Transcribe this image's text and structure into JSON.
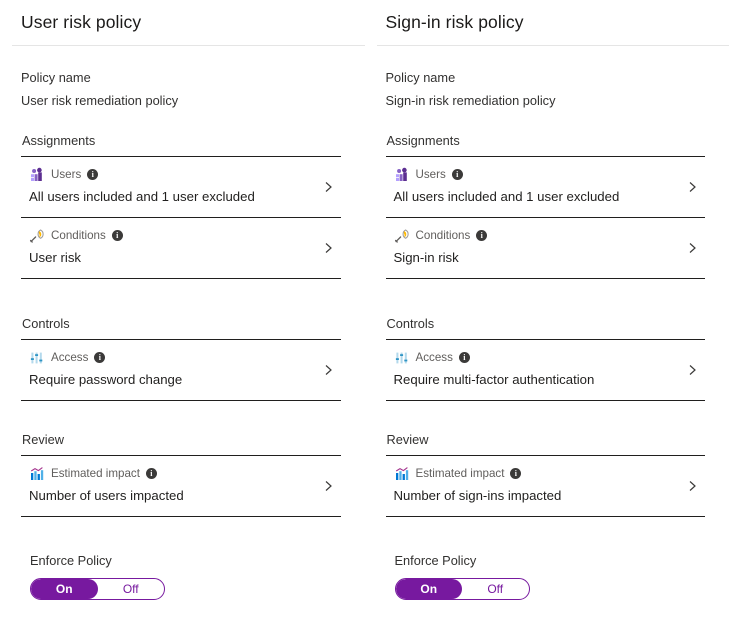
{
  "theme": {
    "accent_purple": "#77199f",
    "text_primary": "#201f1e",
    "text_secondary": "#605e5c",
    "divider": "#201f1e",
    "header_divider": "#e5e5e5"
  },
  "panels": [
    {
      "id": "user-risk-policy",
      "title": "User risk policy",
      "policy_name_label": "Policy name",
      "policy_name_value": "User risk remediation policy",
      "sections": [
        {
          "id": "assignments",
          "title": "Assignments",
          "rows": [
            {
              "id": "users",
              "icon": "users-icon",
              "label": "Users",
              "info": "i",
              "value": "All users included and 1 user excluded",
              "chevron": "chevron-right-icon"
            },
            {
              "id": "conditions",
              "icon": "conditions-icon",
              "label": "Conditions",
              "info": "i",
              "value": "User risk",
              "chevron": "chevron-right-icon"
            }
          ]
        },
        {
          "id": "controls",
          "title": "Controls",
          "rows": [
            {
              "id": "access",
              "icon": "access-icon",
              "label": "Access",
              "info": "i",
              "value": "Require password change",
              "chevron": "chevron-right-icon"
            }
          ]
        },
        {
          "id": "review",
          "title": "Review",
          "rows": [
            {
              "id": "estimated-impact",
              "icon": "estimated-impact-icon",
              "label": "Estimated impact",
              "info": "i",
              "value": "Number of users impacted",
              "chevron": "chevron-right-icon"
            }
          ]
        }
      ],
      "enforce": {
        "label": "Enforce Policy",
        "on_label": "On",
        "off_label": "Off",
        "selected": "On"
      }
    },
    {
      "id": "sign-in-risk-policy",
      "title": "Sign-in risk policy",
      "policy_name_label": "Policy name",
      "policy_name_value": "Sign-in risk remediation policy",
      "sections": [
        {
          "id": "assignments",
          "title": "Assignments",
          "rows": [
            {
              "id": "users",
              "icon": "users-icon",
              "label": "Users",
              "info": "i",
              "value": "All users included and 1 user excluded",
              "chevron": "chevron-right-icon"
            },
            {
              "id": "conditions",
              "icon": "conditions-icon",
              "label": "Conditions",
              "info": "i",
              "value": "Sign-in risk",
              "chevron": "chevron-right-icon"
            }
          ]
        },
        {
          "id": "controls",
          "title": "Controls",
          "rows": [
            {
              "id": "access",
              "icon": "access-icon",
              "label": "Access",
              "info": "i",
              "value": "Require multi-factor authentication",
              "chevron": "chevron-right-icon"
            }
          ]
        },
        {
          "id": "review",
          "title": "Review",
          "rows": [
            {
              "id": "estimated-impact",
              "icon": "estimated-impact-icon",
              "label": "Estimated impact",
              "info": "i",
              "value": "Number of sign-ins impacted",
              "chevron": "chevron-right-icon"
            }
          ]
        }
      ],
      "enforce": {
        "label": "Enforce Policy",
        "on_label": "On",
        "off_label": "Off",
        "selected": "On"
      }
    }
  ]
}
